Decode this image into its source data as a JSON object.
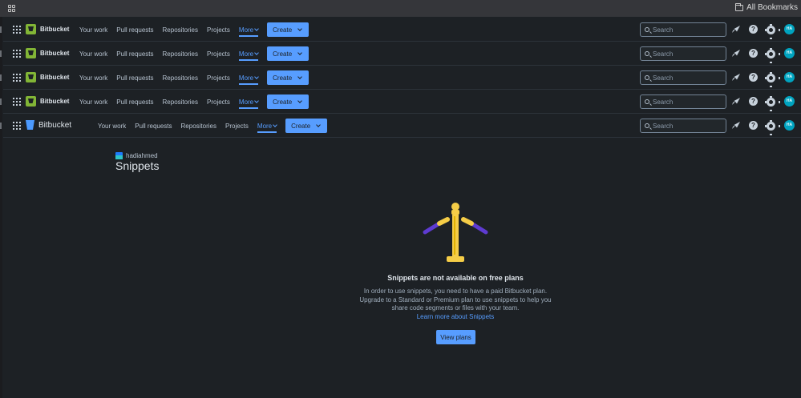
{
  "browser": {
    "all_bookmarks_label": "All Bookmarks"
  },
  "header": {
    "brand": "Bitbucket",
    "nav": [
      "Your work",
      "Pull requests",
      "Repositories",
      "Projects"
    ],
    "more_label": "More",
    "create_label": "Create",
    "search_placeholder": "Search",
    "help_glyph": "?",
    "avatar_initials": "HA",
    "icons": [
      "app-switcher-icon",
      "bitbucket-logo",
      "rocket-icon",
      "help-icon",
      "settings-icon"
    ]
  },
  "workspace": {
    "name": "hadiahmed"
  },
  "page": {
    "title": "Snippets"
  },
  "empty_state": {
    "title": "Snippets are not available on free plans",
    "body_lines": [
      "In order to use snippets, you need to have a paid Bitbucket plan.",
      "Upgrade to a Standard or Premium plan to use snippets to help you",
      "share code segments or files with your team."
    ],
    "link_label": "Learn more about Snippets",
    "button_label": "View plans"
  },
  "colors": {
    "background": "#1d2125",
    "accent": "#579dff",
    "brand_green": "#82b536",
    "avatar": "#00a3bf",
    "illustration_gold": "#f5cd47",
    "illustration_purple": "#5e3bd1"
  }
}
